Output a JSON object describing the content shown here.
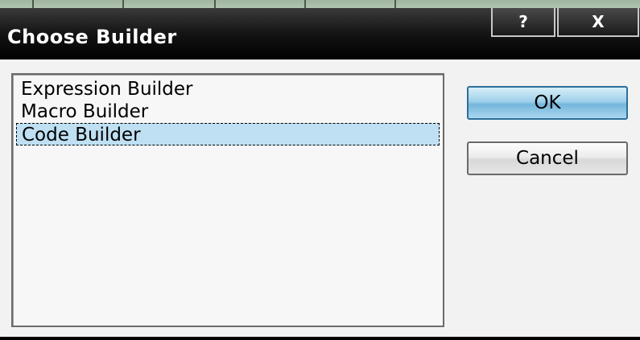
{
  "dialog": {
    "title": "Choose Builder",
    "help_symbol": "?",
    "close_symbol": "X"
  },
  "builders": {
    "items": [
      {
        "label": "Expression Builder"
      },
      {
        "label": "Macro Builder"
      },
      {
        "label": "Code Builder"
      }
    ],
    "selected": "Code Builder"
  },
  "buttons": {
    "ok_label": "OK",
    "cancel_label": "Cancel"
  },
  "colors": {
    "selection": "#bfe0f2",
    "ok_accent": "#74b6dc",
    "titlebar": "#141414"
  }
}
